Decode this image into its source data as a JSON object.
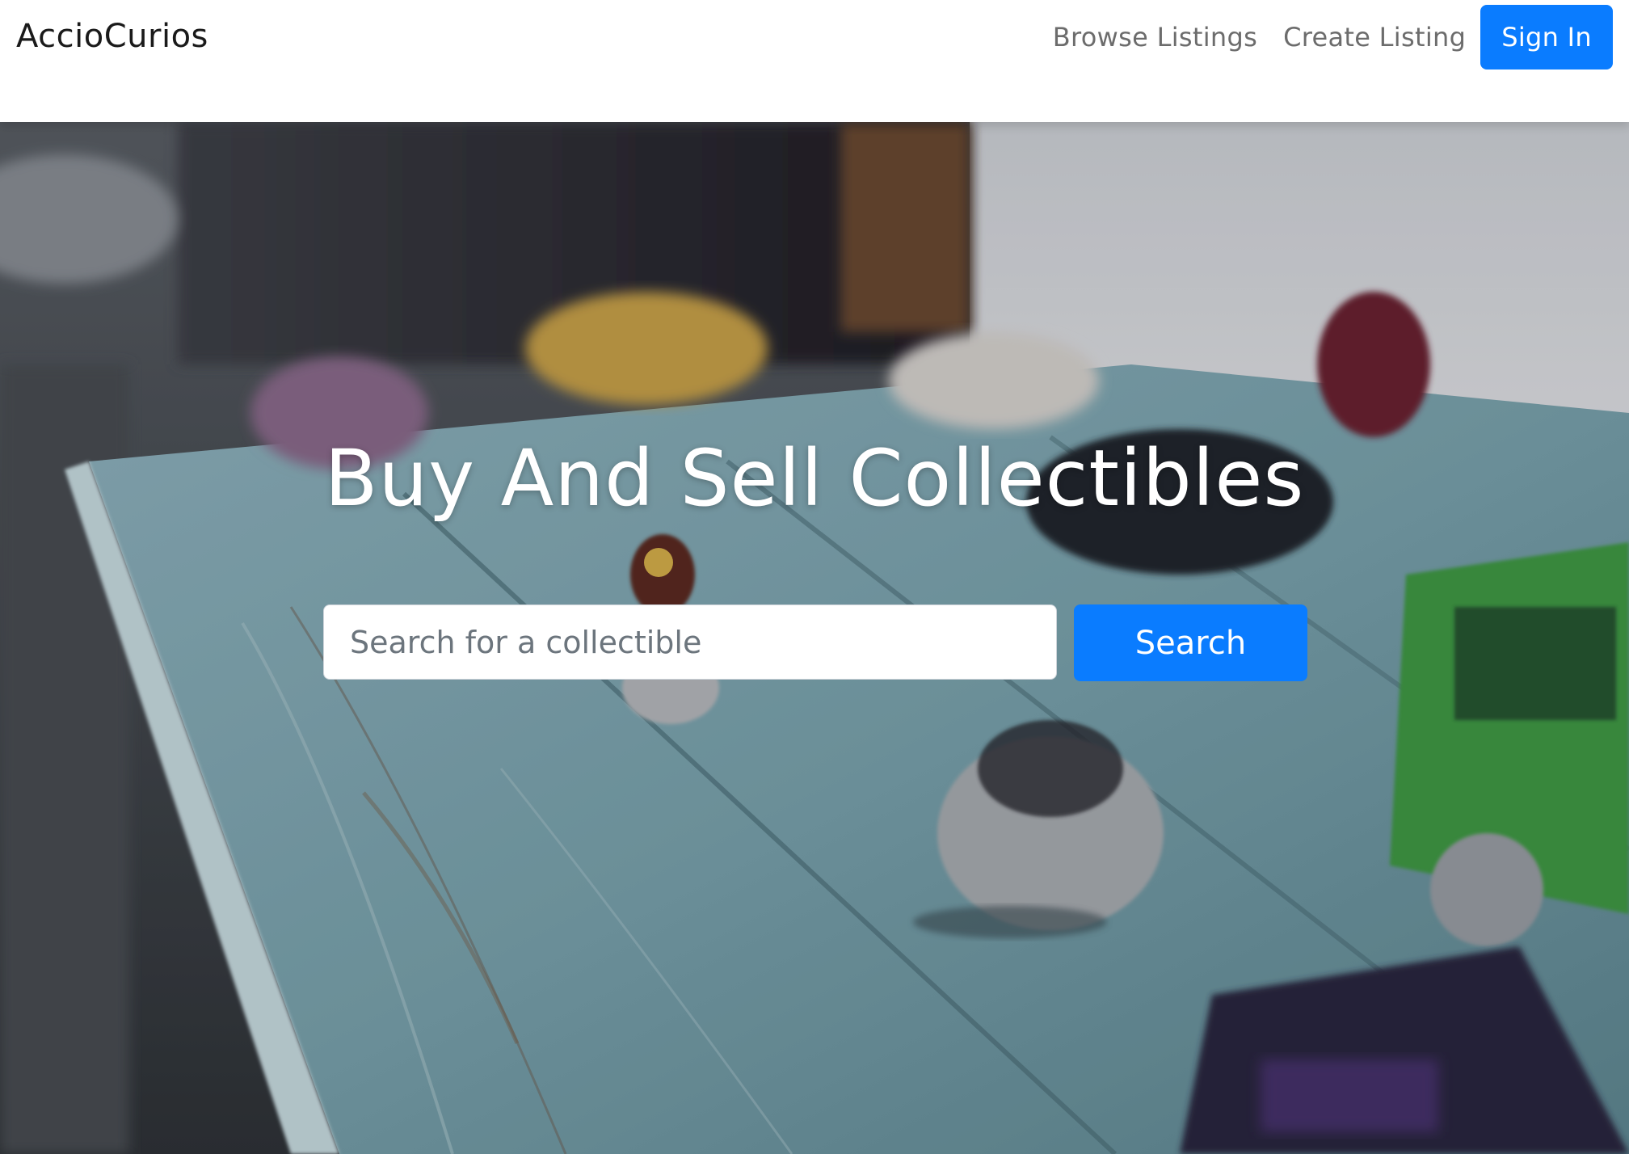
{
  "navbar": {
    "brand": "AccioCurios",
    "links": [
      {
        "label": "Browse Listings"
      },
      {
        "label": "Create Listing"
      }
    ],
    "signin_label": "Sign In"
  },
  "hero": {
    "title": "Buy And Sell Collectibles",
    "search": {
      "placeholder": "Search for a collectible",
      "value": "",
      "button_label": "Search"
    }
  },
  "colors": {
    "primary": "#0a7cff",
    "nav_text": "#6c6c6c",
    "brand_text": "#1a1a1a"
  }
}
